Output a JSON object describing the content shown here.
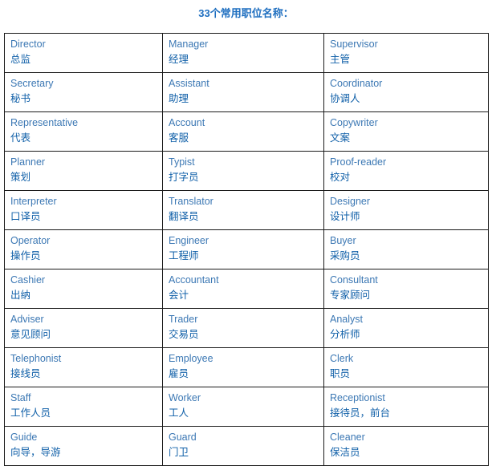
{
  "document": {
    "title": "33个常用职位名称：",
    "title_color": "#1F6FC0",
    "english_color": "#3C78B4",
    "chinese_color": "#0F5FA8",
    "border_color": "#1a1a1a",
    "background_color": "#ffffff"
  },
  "table": {
    "columns": 3,
    "rows": [
      [
        {
          "en": "Director",
          "zh": "总监"
        },
        {
          "en": "Manager",
          "zh": "经理"
        },
        {
          "en": "Supervisor",
          "zh": "主管"
        }
      ],
      [
        {
          "en": "Secretary",
          "zh": "秘书"
        },
        {
          "en": "Assistant",
          "zh": "助理"
        },
        {
          "en": "Coordinator",
          "zh": "协调人"
        }
      ],
      [
        {
          "en": "Representative",
          "zh": "代表"
        },
        {
          "en": "Account",
          "zh": "客服"
        },
        {
          "en": "Copywriter",
          "zh": "文案"
        }
      ],
      [
        {
          "en": "Planner",
          "zh": "策划"
        },
        {
          "en": "Typist",
          "zh": "打字员"
        },
        {
          "en": "Proof-reader",
          "zh": "校对"
        }
      ],
      [
        {
          "en": "Interpreter",
          "zh": "口译员"
        },
        {
          "en": "Translator",
          "zh": "翻译员"
        },
        {
          "en": "Designer",
          "zh": "设计师"
        }
      ],
      [
        {
          "en": "Operator",
          "zh": "操作员"
        },
        {
          "en": "Engineer",
          "zh": "工程师"
        },
        {
          "en": "Buyer",
          "zh": "采购员"
        }
      ],
      [
        {
          "en": "Cashier",
          "zh": "出纳"
        },
        {
          "en": "Accountant",
          "zh": "会计"
        },
        {
          "en": "Consultant",
          "zh": "专家顾问"
        }
      ],
      [
        {
          "en": "Adviser",
          "zh": "意见顾问"
        },
        {
          "en": "Trader",
          "zh": "交易员"
        },
        {
          "en": "Analyst",
          "zh": "分析师"
        }
      ],
      [
        {
          "en": "Telephonist",
          "zh": "接线员"
        },
        {
          "en": "Employee",
          "zh": "雇员"
        },
        {
          "en": "Clerk",
          "zh": "职员"
        }
      ],
      [
        {
          "en": "Staff",
          "zh": "工作人员"
        },
        {
          "en": "Worker",
          "zh": "工人"
        },
        {
          "en": "Receptionist",
          "zh": "接待员，前台"
        }
      ],
      [
        {
          "en": "Guide",
          "zh": "向导，导游"
        },
        {
          "en": "Guard",
          "zh": "门卫"
        },
        {
          "en": "Cleaner",
          "zh": "保洁员"
        }
      ]
    ]
  }
}
